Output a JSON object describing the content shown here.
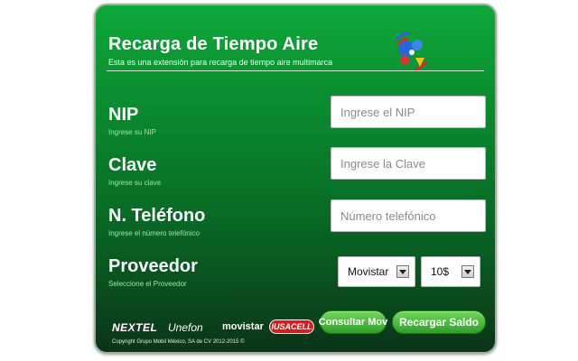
{
  "header": {
    "title": "Recarga de Tiempo Aire",
    "subtitle": "Esta es una extensión para recarga de tiempo aire multimarca"
  },
  "fields": {
    "nip": {
      "label": "NIP",
      "hint": "Ingrese su NIP",
      "placeholder": "Ingrese el NIP",
      "value": ""
    },
    "clave": {
      "label": "Clave",
      "hint": "Ingrese su clave",
      "placeholder": "Ingrese la Clave",
      "value": ""
    },
    "telefono": {
      "label": "N. Teléfono",
      "hint": "Ingrese el número telefónico",
      "placeholder": "Número telefónico",
      "value": ""
    },
    "proveedor": {
      "label": "Proveedor",
      "hint": "Seleccione el Proveedor"
    }
  },
  "selects": {
    "provider": {
      "selected": "Movistar"
    },
    "amount": {
      "selected": "10$"
    }
  },
  "buttons": {
    "consultar": "Consultar Mov",
    "recargar": "Recargar Saldo"
  },
  "brands": {
    "nextel": "NEXTEL",
    "unefon": "Unefon",
    "movistar": "movistar",
    "iusacell": "IUSACELL"
  },
  "footer": {
    "copyright": "Copyright Grupo Mobil México, SA de CV 2012-2015 ©"
  },
  "icons": {
    "logo": "signal-network-logo-icon",
    "dropdown": "dropdown-arrow-icon"
  },
  "colors": {
    "panel_top": "#0ea83a",
    "panel_bottom": "#0b3318",
    "button": "#3fb535",
    "hint": "#9be6a8"
  }
}
